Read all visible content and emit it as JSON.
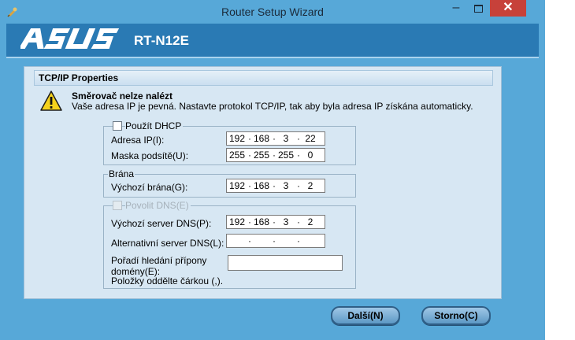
{
  "window": {
    "title": "Router Setup Wizard",
    "minimize": "–",
    "close": "✕"
  },
  "banner": {
    "brand": "ASUS",
    "model": "RT-N12E"
  },
  "section": {
    "title": "TCP/IP Properties"
  },
  "warning": {
    "icon": "warning-triangle-icon",
    "title": "Směrovač nelze nalézt",
    "text": "Vaše adresa IP je pevná. Nastavte protokol TCP/IP, tak aby byla adresa IP získána automaticky."
  },
  "ip_group": {
    "dhcp_label": "Použít DHCP",
    "dhcp_checked": false,
    "ip_label": "Adresa IP(I):",
    "ip_value": [
      "192",
      "168",
      "3",
      "22"
    ],
    "mask_label": "Maska podsítě(U):",
    "mask_value": [
      "255",
      "255",
      "255",
      "0"
    ]
  },
  "gateway_group": {
    "title": "Brána",
    "gateway_label": "Výchozí brána(G):",
    "gateway_value": [
      "192",
      "168",
      "3",
      "2"
    ]
  },
  "dns_group": {
    "enable_label": "Povolit DNS(E)",
    "enable_disabled": true,
    "dns_label": "Výchozí server DNS(P):",
    "dns_value": [
      "192",
      "168",
      "3",
      "2"
    ],
    "alt_dns_label": "Alternativní server DNS(L):",
    "alt_dns_value": [
      "",
      "",
      "",
      ""
    ],
    "suffix_label": "Pořadí hledání přípony domény(E):",
    "suffix_value": "",
    "suffix_hint": "Položky oddělte čárkou (,)."
  },
  "buttons": {
    "next": "Další(N)",
    "cancel": "Storno(C)"
  },
  "colors": {
    "window": "#57a8d8",
    "banner": "#2a7ab4",
    "panel": "#d7e7f3",
    "close": "#c7413a"
  }
}
